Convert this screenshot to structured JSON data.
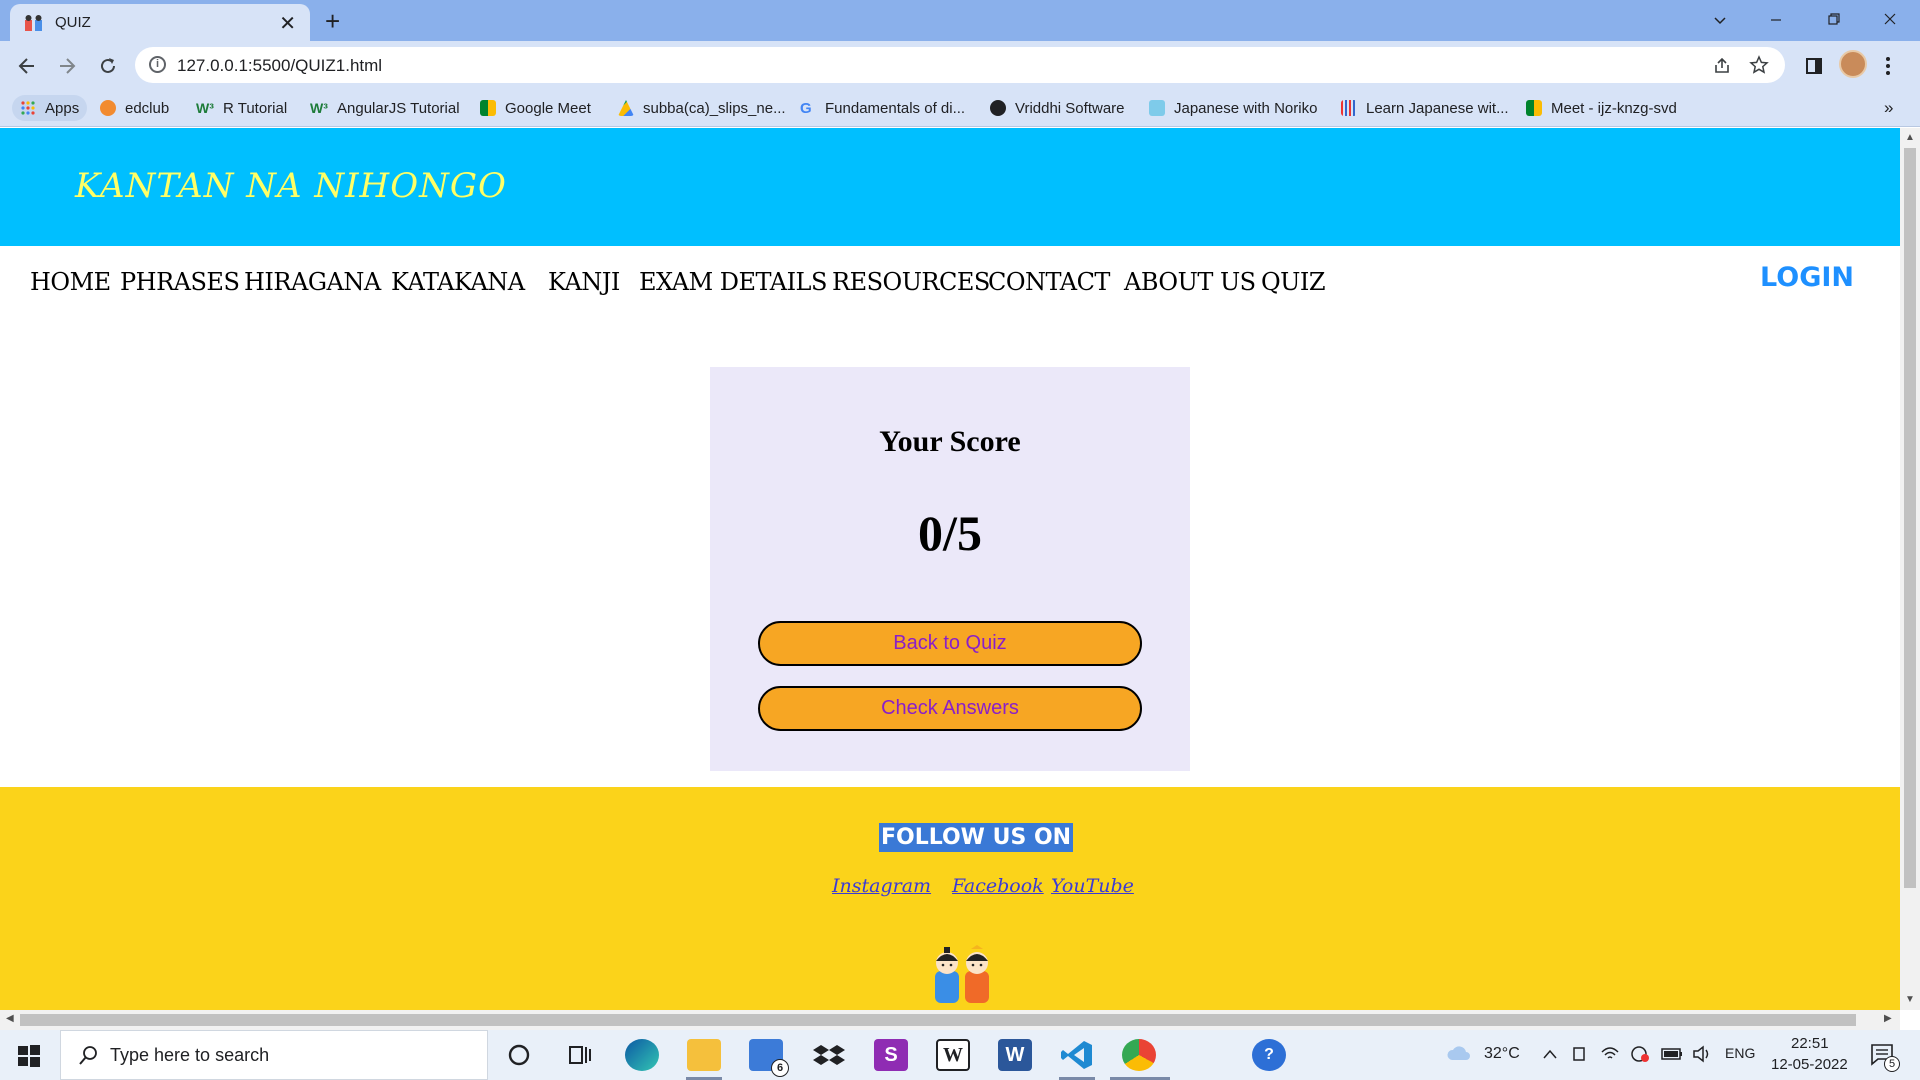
{
  "browser": {
    "tab_title": "QUIZ",
    "tab_close": "✕",
    "new_tab": "+",
    "url": "127.0.0.1:5500/QUIZ1.html",
    "bookmarks": [
      "Apps",
      "edclub",
      "R Tutorial",
      "AngularJS Tutorial",
      "Google Meet",
      "subba(ca)_slips_ne...",
      "Fundamentals of di...",
      "Vriddhi Software",
      "Japanese with Noriko",
      "Learn Japanese wit...",
      "Meet - ijz-knzg-svd"
    ],
    "more_bookmarks": "»"
  },
  "site": {
    "title": "KANTAN NA NIHONGO",
    "nav": [
      "HOME",
      "PHRASES",
      "HIRAGANA",
      "KATAKANA",
      "KANJI",
      "EXAM DETAILS",
      "RESOURCES",
      "CONTACT",
      "ABOUT US",
      "QUIZ"
    ],
    "login": "LOGIN"
  },
  "score": {
    "title": "Your Score",
    "value": "0/5",
    "back_button": "Back to Quiz",
    "check_button": "Check Answers"
  },
  "footer": {
    "follow": "FOLLOW US ON",
    "links": [
      "Instagram",
      "Facebook",
      "YouTube"
    ]
  },
  "taskbar": {
    "search_placeholder": "Type here to search",
    "mail_badge": "6",
    "weather": "32°C",
    "language": "ENG",
    "time": "22:51",
    "date": "12-05-2022",
    "notifications": "5"
  },
  "colors": {
    "header_bg": "#00bfff",
    "title_color": "#ffff66",
    "login_color": "#1e90ff",
    "card_bg": "#ebe8f9",
    "button_bg": "#f7a623",
    "button_text": "#8a1fc9",
    "footer_bg": "#fbd31a",
    "follow_highlight": "#3a79d6"
  }
}
